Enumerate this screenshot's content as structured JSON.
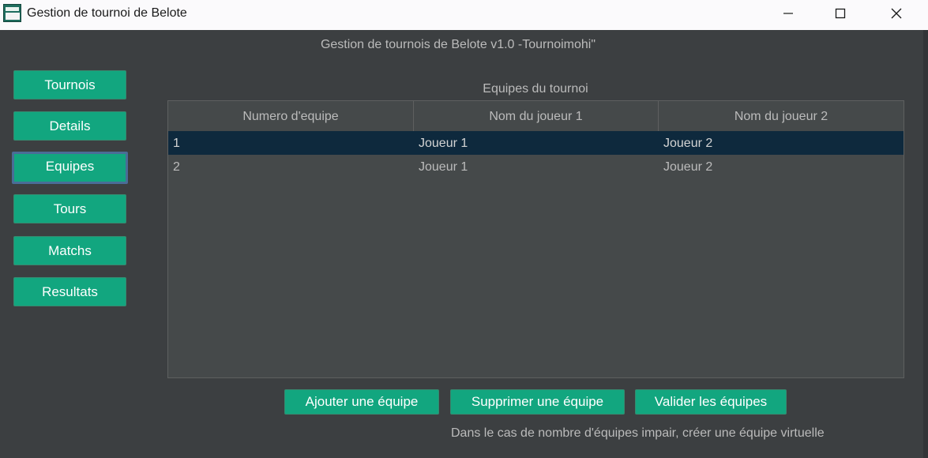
{
  "window": {
    "title": "Gestion de tournoi de Belote",
    "icon": "belote-app-icon",
    "controls": [
      "minimize-icon",
      "maximize-icon",
      "close-icon"
    ]
  },
  "header": {
    "text": "Gestion de tournois de Belote v1.0 -Tournoimohi\""
  },
  "sidebar": {
    "items": [
      {
        "label": "Tournois"
      },
      {
        "label": "Details"
      },
      {
        "label": "Equipes",
        "active": true
      },
      {
        "label": "Tours"
      },
      {
        "label": "Matchs"
      },
      {
        "label": "Resultats"
      }
    ]
  },
  "table": {
    "caption": "Equipes du tournoi",
    "columns": [
      "Numero d'equipe",
      "Nom du joueur 1",
      "Nom du joueur 2"
    ],
    "rows": [
      {
        "cells": [
          "1",
          "Joueur 1",
          "Joueur 2"
        ],
        "selected": true
      },
      {
        "cells": [
          "2",
          "Joueur 1",
          "Joueur 2"
        ],
        "selected": false
      }
    ]
  },
  "actions": {
    "add": "Ajouter une équipe",
    "remove": "Supprimer une équipe",
    "validate": "Valider les équipes"
  },
  "note": "Dans le cas de nombre d'équipes impair, créer une équipe virtuelle",
  "colors": {
    "accent": "#12a67f",
    "background": "#3c3f41",
    "table_bg": "#45494a",
    "selection": "#0e293d",
    "active_border": "#4a6d97",
    "text": "#bbbbbb"
  }
}
